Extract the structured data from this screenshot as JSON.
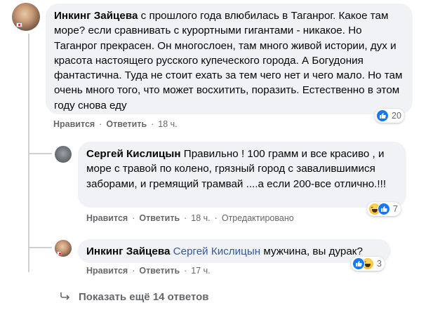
{
  "comments": [
    {
      "author": "Инкинг Зайцева",
      "text": "с прошлого года влюбилась в Таганрог. Какое там море? если сравнивать с курортными гигантами - никакое. Но Таганрог прекрасен. Он многослоен, там много живой истории, дух и красота настоящего русского купеческого города. А Богудония фантастична. Туда не стоит ехать за тем чего нет и чего мало. Но там очень много того, что может восхитить, поразить. Естественно в этом году снова еду",
      "actions": {
        "like": "Нравится",
        "reply": "Ответить",
        "time": "18 ч."
      },
      "reactions": {
        "icons": [
          "like-icon"
        ],
        "count": "20"
      }
    },
    {
      "author": "Сергей Кислицын",
      "text": "Правильно ! 100 грамм и все красиво , и море с травой по колено, грязный город с завалившимися заборами, и гремящий трамвай ....а если 200-все отлично.!!!",
      "actions": {
        "like": "Нравится",
        "reply": "Ответить",
        "time": "18 ч.",
        "edited": "Отредактировано"
      },
      "reactions": {
        "icons": [
          "haha-icon",
          "like-icon"
        ],
        "count": "7"
      }
    },
    {
      "author": "Инкинг Зайцева",
      "mention": "Сергей Кислицын",
      "text": "мужчина, вы дурак?",
      "actions": {
        "like": "Нравится",
        "reply": "Ответить",
        "time": "17 ч."
      },
      "reactions": {
        "icons": [
          "like-icon",
          "haha-icon"
        ],
        "count": "3"
      }
    }
  ],
  "show_more": {
    "label": "Показать ещё 14 ответов"
  },
  "colors": {
    "bubble": "#f0f2f5",
    "link": "#385898",
    "muted": "#65676b",
    "like_blue": "#1877f2"
  }
}
